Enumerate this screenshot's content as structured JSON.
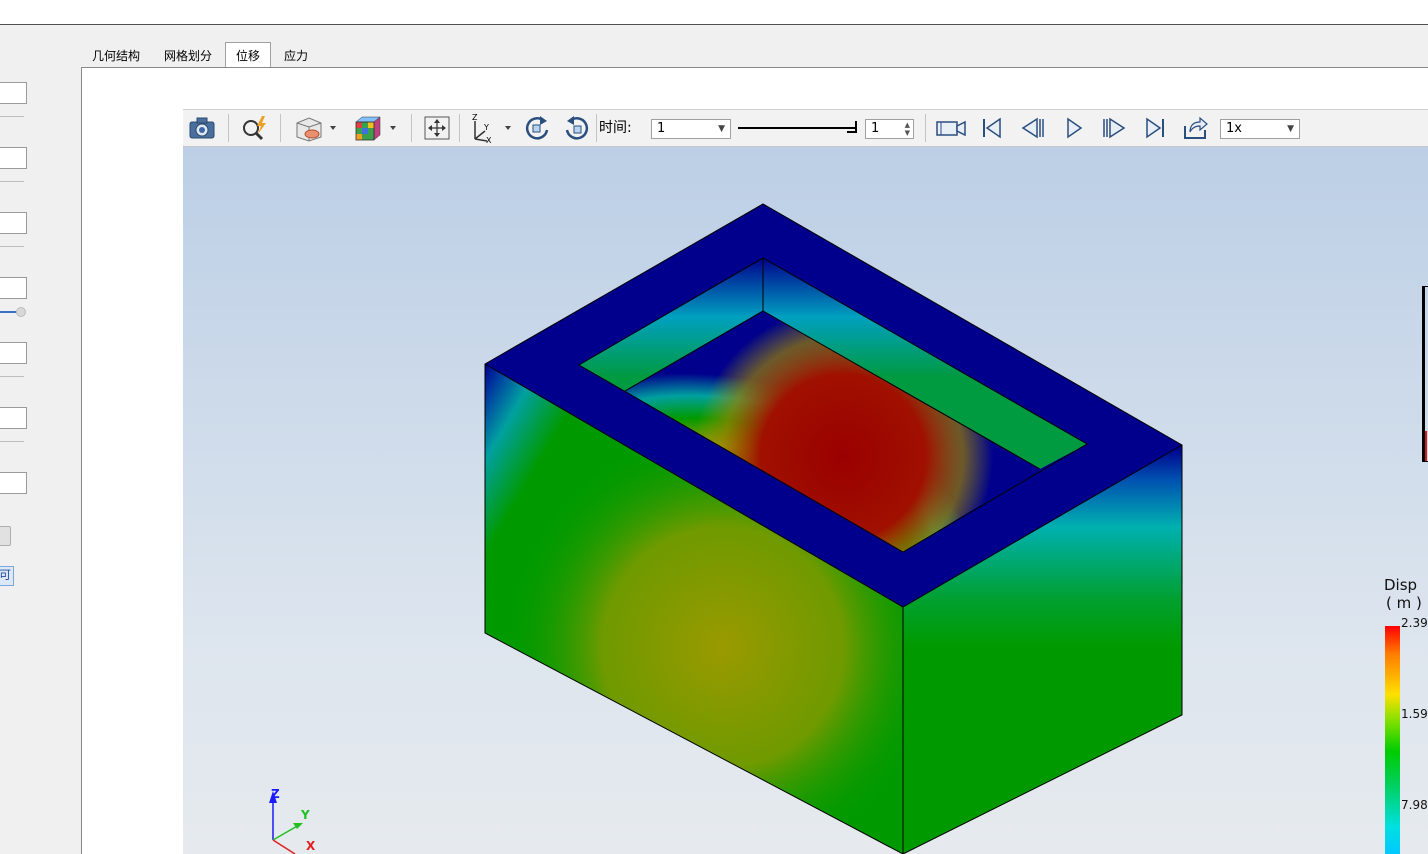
{
  "tabs": [
    {
      "label": "几何结构",
      "active": false
    },
    {
      "label": "网格划分",
      "active": false
    },
    {
      "label": "位移",
      "active": true
    },
    {
      "label": "应力",
      "active": false
    }
  ],
  "left_panel": {
    "link_label": "可"
  },
  "toolbar": {
    "time_label": "时间:",
    "time_value": "1",
    "frame_value": "1",
    "speed_value": "1x",
    "icons": [
      "camera-icon",
      "magnify-flash-icon",
      "section-view-icon",
      "color-cube-icon",
      "fit-view-icon",
      "axes-icon",
      "rotate-ccw-icon",
      "rotate-cw-icon",
      "record-video-icon",
      "first-frame-icon",
      "previous-frame-icon",
      "play-icon",
      "next-frame-icon",
      "last-frame-icon",
      "export-icon"
    ]
  },
  "viewport": {
    "axis_labels": {
      "z": "Z",
      "y": "Y",
      "x": "X"
    },
    "legend": {
      "title": "Disp",
      "unit": "( m )",
      "max_label": "2.39",
      "mid_label": "1.59",
      "low_label": "7.98"
    },
    "colors": {
      "low": "#00008c",
      "mid": "#009a00",
      "high": "#9a0000"
    }
  }
}
